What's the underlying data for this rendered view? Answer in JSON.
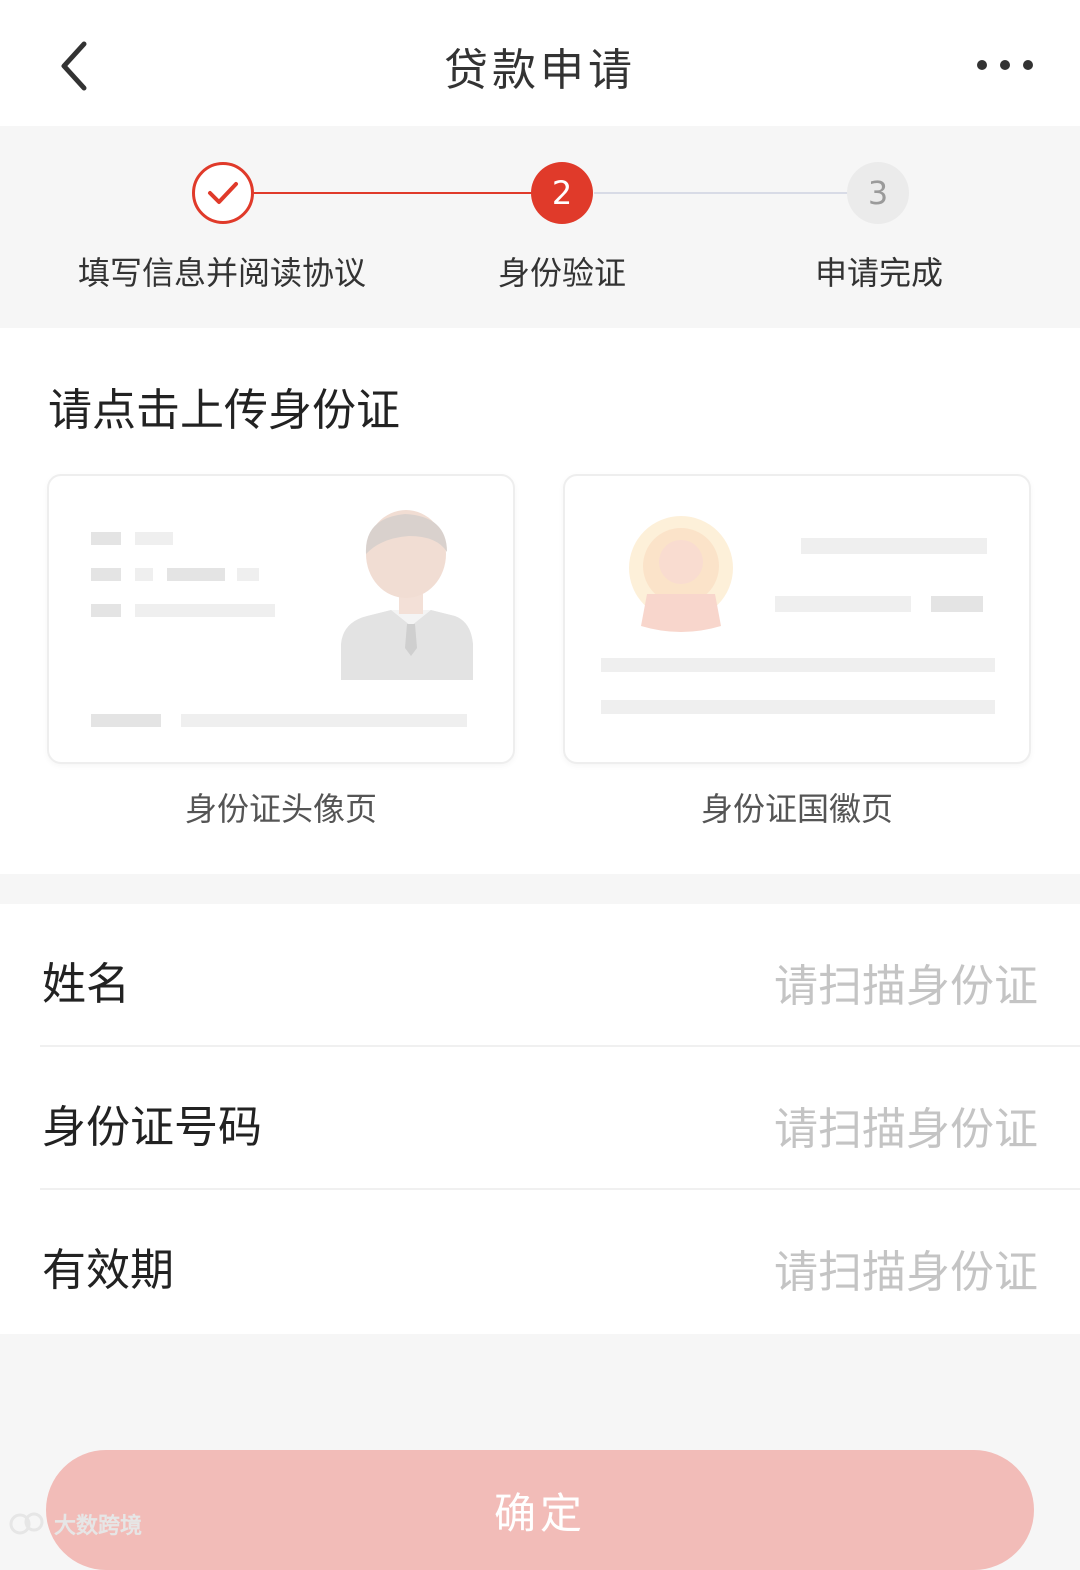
{
  "nav": {
    "title": "贷款申请"
  },
  "steps": [
    {
      "number": "",
      "label": "填写信息并阅读协议",
      "state": "done"
    },
    {
      "number": "2",
      "label": "身份验证",
      "state": "active"
    },
    {
      "number": "3",
      "label": "申请完成",
      "state": "pending"
    }
  ],
  "upload": {
    "title": "请点击上传身份证",
    "front_label": "身份证头像页",
    "back_label": "身份证国徽页"
  },
  "form": {
    "rows": [
      {
        "label": "姓名",
        "value": "请扫描身份证"
      },
      {
        "label": "身份证号码",
        "value": "请扫描身份证"
      },
      {
        "label": "有效期",
        "value": "请扫描身份证"
      }
    ]
  },
  "confirm_label": "确定",
  "watermark": "大数跨境",
  "colors": {
    "accent": "#e03a2a",
    "button_disabled": "#f2bcb8",
    "placeholder": "#c4c4c4"
  }
}
